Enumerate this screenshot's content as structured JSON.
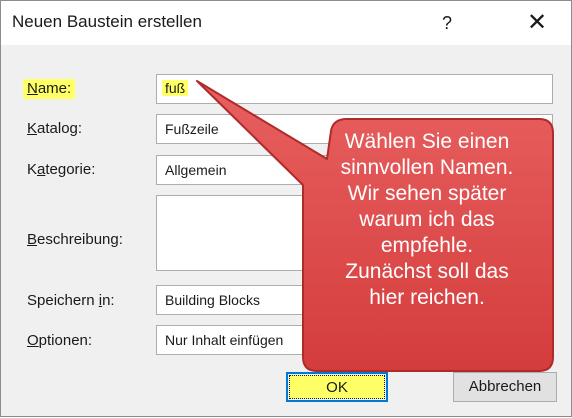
{
  "dialog": {
    "title": "Neuen Baustein erstellen",
    "help_label": "?",
    "close_label": "✕"
  },
  "form": {
    "name": {
      "label_mnemonic": "N",
      "label_rest": "ame:",
      "value": "fuß"
    },
    "gallery": {
      "label_mnemonic": "K",
      "label_rest": "atalog:",
      "value": "Fußzeile"
    },
    "category": {
      "label_pre": "K",
      "label_mnemonic": "a",
      "label_rest": "tegorie:",
      "value": "Allgemein"
    },
    "description": {
      "label_mnemonic": "B",
      "label_rest": "eschreibung:",
      "value": ""
    },
    "save_in": {
      "label_pre": "Speichern ",
      "label_mnemonic": "i",
      "label_rest": "n:",
      "value": "Building Blocks"
    },
    "options": {
      "label_mnemonic": "O",
      "label_rest": "ptionen:",
      "value": "Nur Inhalt einfügen"
    }
  },
  "buttons": {
    "ok": "OK",
    "cancel": "Abbrechen"
  },
  "callout": {
    "lines": [
      "Wählen Sie einen",
      "sinnvollen Namen.",
      "Wir sehen später",
      "warum ich das",
      "empfehle.",
      "Zunächst soll das",
      "hier reichen."
    ],
    "fill_color": "#e04a4a",
    "stroke_color": "#b02a2a"
  },
  "colors": {
    "highlight": "#ffff66",
    "accent": "#0078d7"
  }
}
